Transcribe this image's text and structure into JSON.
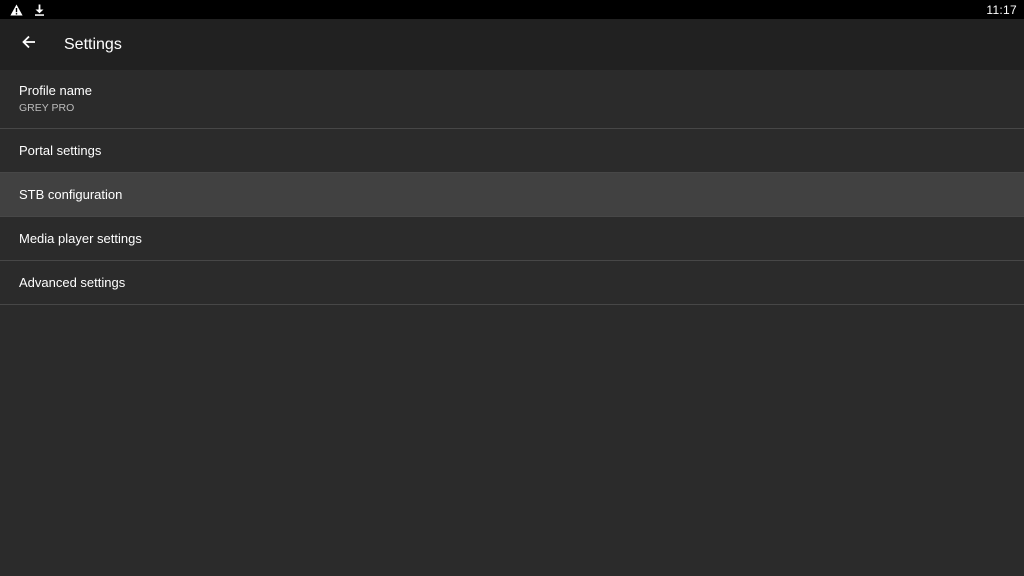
{
  "status_bar": {
    "icons": [
      "warning-icon",
      "download-icon"
    ],
    "clock": "11:17"
  },
  "app_bar": {
    "back_icon": "arrow-back-icon",
    "title": "Settings"
  },
  "settings": {
    "items": [
      {
        "title": "Profile name",
        "summary": "GREY PRO"
      },
      {
        "title": "Portal settings"
      },
      {
        "title": "STB configuration",
        "focused": true
      },
      {
        "title": "Media player settings"
      },
      {
        "title": "Advanced settings"
      }
    ]
  },
  "colors": {
    "status_bar_bg": "#000000",
    "app_bar_bg": "#212121",
    "list_bg": "#2b2b2b",
    "focused_item_bg": "#414141",
    "divider": "#474747",
    "text_primary": "#ffffff",
    "text_secondary": "#bdbdbd"
  }
}
